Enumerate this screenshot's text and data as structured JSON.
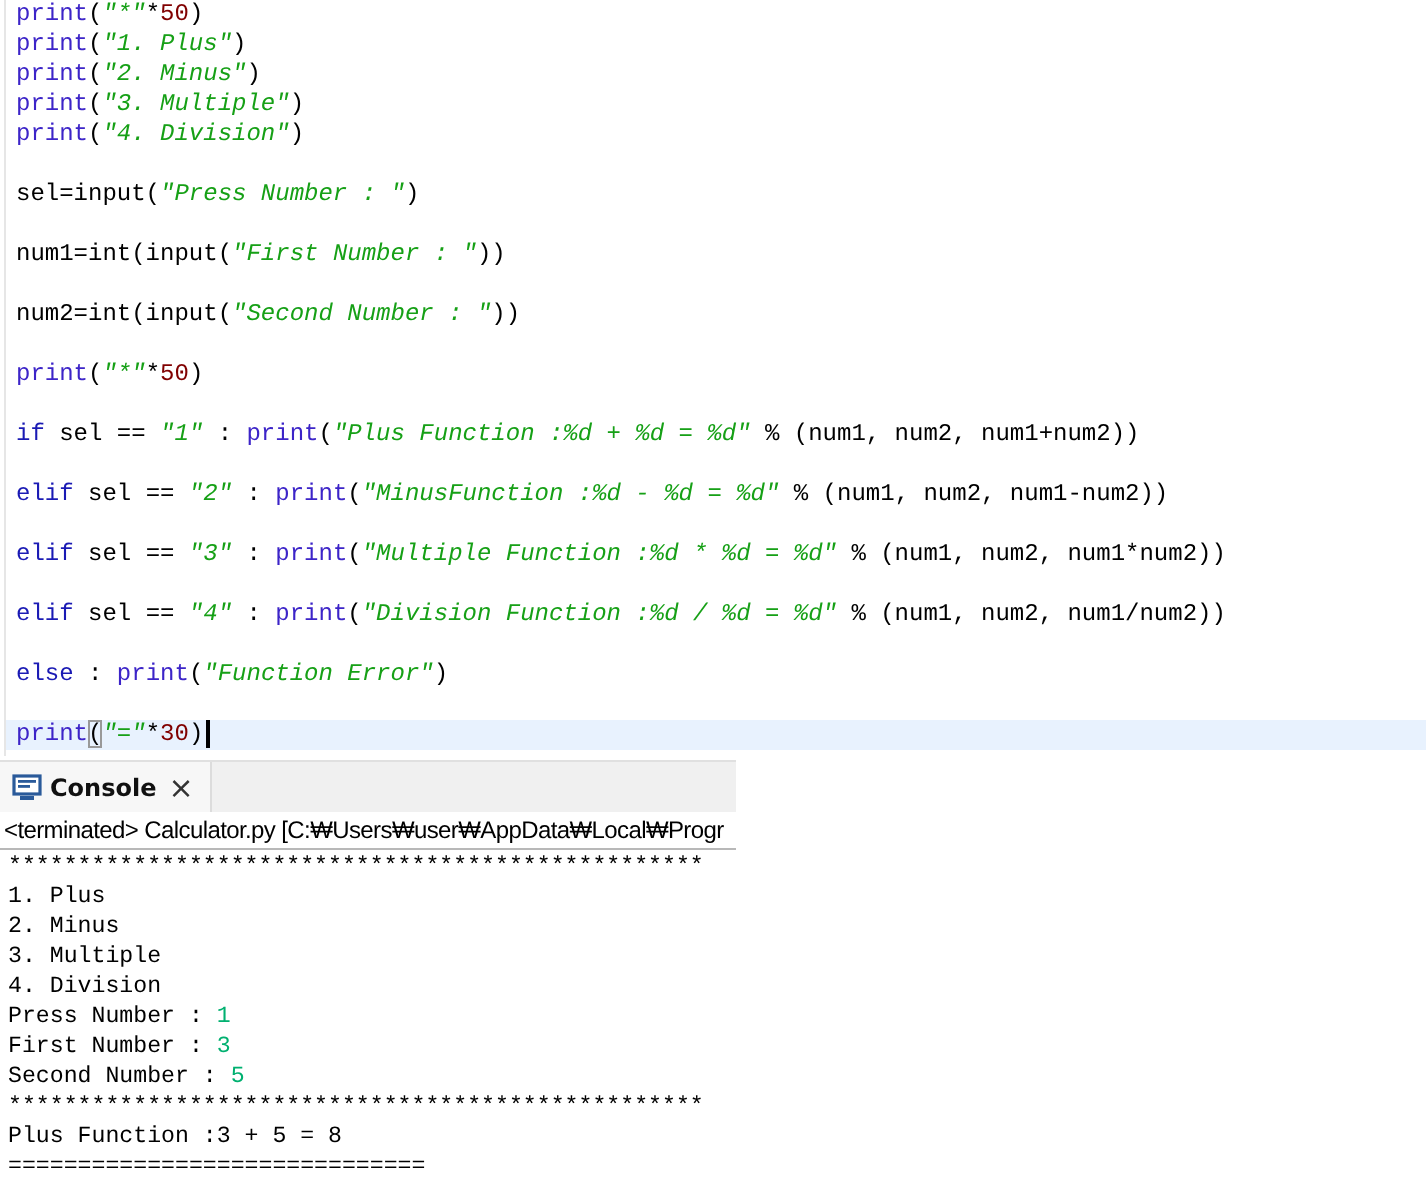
{
  "editor": {
    "lines": [
      {
        "kind": "code",
        "current": false,
        "tokens": [
          {
            "kind": "builtin",
            "text": "print"
          },
          {
            "kind": "plain",
            "text": "("
          },
          {
            "kind": "string",
            "text": "\"*\""
          },
          {
            "kind": "plain",
            "text": "*"
          },
          {
            "kind": "number",
            "text": "50"
          },
          {
            "kind": "plain",
            "text": ")"
          }
        ]
      },
      {
        "kind": "code",
        "current": false,
        "tokens": [
          {
            "kind": "builtin",
            "text": "print"
          },
          {
            "kind": "plain",
            "text": "("
          },
          {
            "kind": "string",
            "text": "\"1. Plus\""
          },
          {
            "kind": "plain",
            "text": ")"
          }
        ]
      },
      {
        "kind": "code",
        "current": false,
        "tokens": [
          {
            "kind": "builtin",
            "text": "print"
          },
          {
            "kind": "plain",
            "text": "("
          },
          {
            "kind": "string",
            "text": "\"2. Minus\""
          },
          {
            "kind": "plain",
            "text": ")"
          }
        ]
      },
      {
        "kind": "code",
        "current": false,
        "tokens": [
          {
            "kind": "builtin",
            "text": "print"
          },
          {
            "kind": "plain",
            "text": "("
          },
          {
            "kind": "string",
            "text": "\"3. Multiple\""
          },
          {
            "kind": "plain",
            "text": ")"
          }
        ]
      },
      {
        "kind": "code",
        "current": false,
        "tokens": [
          {
            "kind": "builtin",
            "text": "print"
          },
          {
            "kind": "plain",
            "text": "("
          },
          {
            "kind": "string",
            "text": "\"4. Division\""
          },
          {
            "kind": "plain",
            "text": ")"
          }
        ]
      },
      {
        "kind": "blank"
      },
      {
        "kind": "code",
        "current": false,
        "tokens": [
          {
            "kind": "plain",
            "text": "sel=input("
          },
          {
            "kind": "string",
            "text": "\"Press Number : \""
          },
          {
            "kind": "plain",
            "text": ")"
          }
        ]
      },
      {
        "kind": "blank"
      },
      {
        "kind": "code",
        "current": false,
        "tokens": [
          {
            "kind": "plain",
            "text": "num1=int(input("
          },
          {
            "kind": "string",
            "text": "\"First Number : \""
          },
          {
            "kind": "plain",
            "text": "))"
          }
        ]
      },
      {
        "kind": "blank"
      },
      {
        "kind": "code",
        "current": false,
        "tokens": [
          {
            "kind": "plain",
            "text": "num2=int(input("
          },
          {
            "kind": "string",
            "text": "\"Second Number : \""
          },
          {
            "kind": "plain",
            "text": "))"
          }
        ]
      },
      {
        "kind": "blank"
      },
      {
        "kind": "code",
        "current": false,
        "tokens": [
          {
            "kind": "builtin",
            "text": "print"
          },
          {
            "kind": "plain",
            "text": "("
          },
          {
            "kind": "string",
            "text": "\"*\""
          },
          {
            "kind": "plain",
            "text": "*"
          },
          {
            "kind": "number",
            "text": "50"
          },
          {
            "kind": "plain",
            "text": ")"
          }
        ]
      },
      {
        "kind": "blank"
      },
      {
        "kind": "code",
        "current": false,
        "tokens": [
          {
            "kind": "keyword",
            "text": "if"
          },
          {
            "kind": "plain",
            "text": " sel == "
          },
          {
            "kind": "string",
            "text": "\"1\""
          },
          {
            "kind": "plain",
            "text": " : "
          },
          {
            "kind": "builtin",
            "text": "print"
          },
          {
            "kind": "plain",
            "text": "("
          },
          {
            "kind": "string",
            "text": "\"Plus Function :%d + %d = %d\""
          },
          {
            "kind": "plain",
            "text": " % (num1, num2, num1+num2))"
          }
        ]
      },
      {
        "kind": "blank"
      },
      {
        "kind": "code",
        "current": false,
        "tokens": [
          {
            "kind": "keyword",
            "text": "elif"
          },
          {
            "kind": "plain",
            "text": " sel == "
          },
          {
            "kind": "string",
            "text": "\"2\""
          },
          {
            "kind": "plain",
            "text": " : "
          },
          {
            "kind": "builtin",
            "text": "print"
          },
          {
            "kind": "plain",
            "text": "("
          },
          {
            "kind": "string",
            "text": "\"MinusFunction :%d - %d = %d\""
          },
          {
            "kind": "plain",
            "text": " % (num1, num2, num1-num2))"
          }
        ]
      },
      {
        "kind": "blank"
      },
      {
        "kind": "code",
        "current": false,
        "tokens": [
          {
            "kind": "keyword",
            "text": "elif"
          },
          {
            "kind": "plain",
            "text": " sel == "
          },
          {
            "kind": "string",
            "text": "\"3\""
          },
          {
            "kind": "plain",
            "text": " : "
          },
          {
            "kind": "builtin",
            "text": "print"
          },
          {
            "kind": "plain",
            "text": "("
          },
          {
            "kind": "string",
            "text": "\"Multiple Function :%d * %d = %d\""
          },
          {
            "kind": "plain",
            "text": " % (num1, num2, num1*num2))"
          }
        ]
      },
      {
        "kind": "blank"
      },
      {
        "kind": "code",
        "current": false,
        "tokens": [
          {
            "kind": "keyword",
            "text": "elif"
          },
          {
            "kind": "plain",
            "text": " sel == "
          },
          {
            "kind": "string",
            "text": "\"4\""
          },
          {
            "kind": "plain",
            "text": " : "
          },
          {
            "kind": "builtin",
            "text": "print"
          },
          {
            "kind": "plain",
            "text": "("
          },
          {
            "kind": "string",
            "text": "\"Division Function :%d / %d = %d\""
          },
          {
            "kind": "plain",
            "text": " % (num1, num2, num1/num2))"
          }
        ]
      },
      {
        "kind": "blank"
      },
      {
        "kind": "code",
        "current": false,
        "tokens": [
          {
            "kind": "keyword",
            "text": "else"
          },
          {
            "kind": "plain",
            "text": " : "
          },
          {
            "kind": "builtin",
            "text": "print"
          },
          {
            "kind": "plain",
            "text": "("
          },
          {
            "kind": "string",
            "text": "\"Function Error\""
          },
          {
            "kind": "plain",
            "text": ")"
          }
        ]
      },
      {
        "kind": "blank"
      },
      {
        "kind": "code",
        "current": true,
        "tokens": [
          {
            "kind": "builtin",
            "text": "print"
          },
          {
            "kind": "matched",
            "text": "("
          },
          {
            "kind": "string",
            "text": "\"=\""
          },
          {
            "kind": "plain",
            "text": "*"
          },
          {
            "kind": "number",
            "text": "30"
          },
          {
            "kind": "plain",
            "text": ")"
          }
        ]
      }
    ]
  },
  "console": {
    "tab": {
      "label": "Console",
      "close": "×"
    },
    "status": "<terminated> Calculator.py [C:₩Users₩user₩AppData₩Local₩Progr",
    "lines": [
      {
        "text": "**************************************************"
      },
      {
        "text": "1. Plus"
      },
      {
        "text": "2. Minus"
      },
      {
        "text": "3. Multiple"
      },
      {
        "text": "4. Division"
      },
      {
        "text": "Press Number : ",
        "input": "1"
      },
      {
        "text": "First Number : ",
        "input": "3"
      },
      {
        "text": "Second Number : ",
        "input": "5"
      },
      {
        "text": "**************************************************"
      },
      {
        "text": "Plus Function :3 + 5 = 8"
      },
      {
        "text": "=============================="
      }
    ]
  }
}
